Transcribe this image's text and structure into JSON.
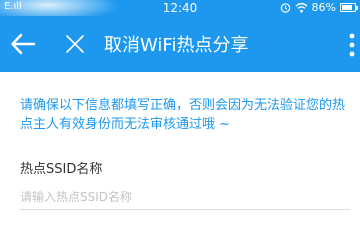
{
  "status_bar": {
    "carrier": "E.ıll",
    "time": "12:40",
    "battery_percent": "86%",
    "battery_level": 0.86,
    "wifi_icon": "wifi-icon",
    "alarm_icon": "alarm-icon"
  },
  "toolbar": {
    "title": "取消WiFi热点分享",
    "background": "#1d98ee"
  },
  "notice": {
    "text": "请确保以下信息都填写正确，否则会因为无法验证您的热点主人有效身份而无法审核通过哦 ~",
    "color": "#1d98ee"
  },
  "form": {
    "ssid_label": "热点SSID名称",
    "ssid_placeholder": "请输入热点SSID名称",
    "ssid_value": ""
  }
}
